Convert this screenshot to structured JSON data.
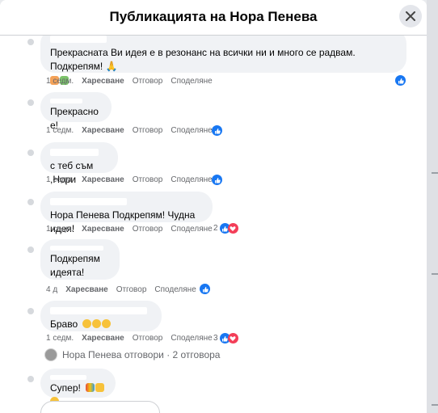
{
  "header": {
    "title": "Публикацията на Нора Пенева"
  },
  "actions": {
    "like": "Харесване",
    "reply": "Отговор",
    "share": "Споделяне"
  },
  "comments": [
    {
      "text": "Прекрасната Ви идея е в резонанс на всички ни и много се радвам. Подкрепям! 🙏",
      "time": "1 седм."
    },
    {
      "text": "Прекрасно е!",
      "time": "1 седм."
    },
    {
      "text": "с теб съм ,Нори",
      "time": "1 седм."
    },
    {
      "text": "Нора Пенева Подкрепям! Чудна идея!",
      "time": "1 седм.",
      "reactions": "2"
    },
    {
      "text_line1": "Подкрепям",
      "text_line2": "идеята!",
      "time": "4 д"
    },
    {
      "text": "Браво",
      "time": "1 седм.",
      "reactions": "3"
    },
    {
      "text": "Супер!"
    }
  ],
  "replies": {
    "label": "Нора Пенева отговори · 2 отговора"
  }
}
